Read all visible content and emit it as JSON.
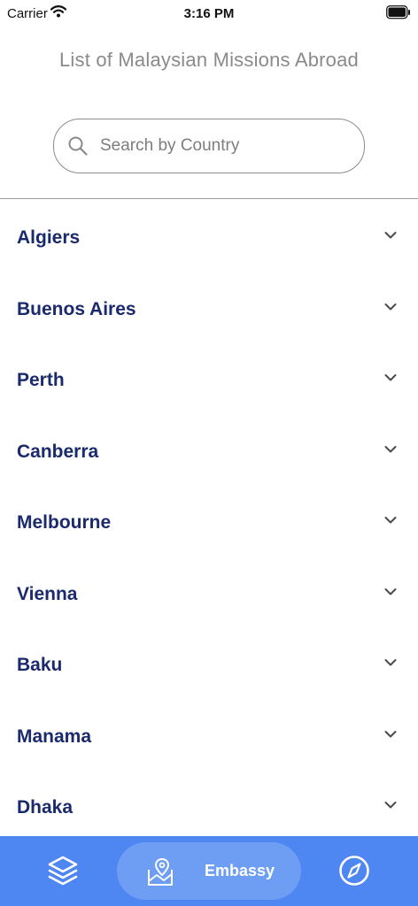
{
  "status_bar": {
    "carrier": "Carrier",
    "time": "3:16 PM"
  },
  "header": {
    "title": "List of Malaysian Missions Abroad"
  },
  "search": {
    "placeholder": "Search by Country",
    "value": ""
  },
  "missions": [
    {
      "label": "Algiers"
    },
    {
      "label": "Buenos Aires"
    },
    {
      "label": "Perth"
    },
    {
      "label": "Canberra"
    },
    {
      "label": "Melbourne"
    },
    {
      "label": "Vienna"
    },
    {
      "label": "Baku"
    },
    {
      "label": "Manama"
    },
    {
      "label": "Dhaka"
    }
  ],
  "tab_bar": {
    "active_label": "Embassy",
    "icons": [
      "layers-icon",
      "map-pin-icon",
      "compass-icon"
    ]
  },
  "colors": {
    "accent": "#4e86f2",
    "active_tab": "#6d9ef4",
    "list_text": "#1a2a6c",
    "title_text": "#8a8a8a"
  }
}
